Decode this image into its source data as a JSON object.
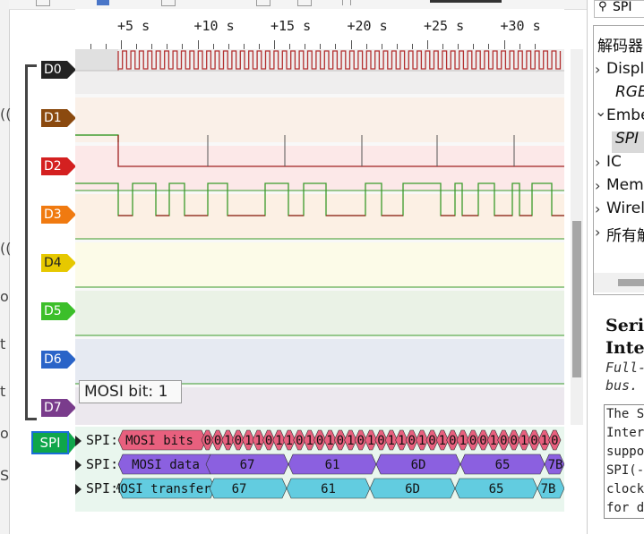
{
  "ruler": {
    "labels": [
      "+5 s",
      "+10 s",
      "+15 s",
      "+20 s",
      "+25 s",
      "+30 s"
    ]
  },
  "channels": [
    {
      "name": "D0",
      "color": "#222222"
    },
    {
      "name": "D1",
      "color": "#8b4a0f"
    },
    {
      "name": "D2",
      "color": "#d42020"
    },
    {
      "name": "D3",
      "color": "#f07a10"
    },
    {
      "name": "D4",
      "color": "#e6c800"
    },
    {
      "name": "D5",
      "color": "#3cbf2a"
    },
    {
      "name": "D6",
      "color": "#2a64c8"
    },
    {
      "name": "D7",
      "color": "#7a3c8c"
    }
  ],
  "tooltip": "MOSI bit: 1",
  "decoder_tag": "SPI",
  "spi_rows": [
    {
      "label": "SPI:",
      "name": "MOSI bits",
      "bits": [
        "0",
        "0",
        "1",
        "0",
        "1",
        "1",
        "0",
        "1",
        "1",
        "0",
        "1",
        "0",
        "1",
        "0",
        "1",
        "0",
        "1",
        "0",
        "1",
        "1",
        "0",
        "1",
        "0",
        "1",
        "0",
        "1",
        "0",
        "0",
        "1",
        "0",
        "0",
        "1",
        "0",
        "1",
        "0",
        "1"
      ]
    },
    {
      "label": "SPI:",
      "name": "MOSI data",
      "values": [
        "67",
        "61",
        "6D",
        "65",
        "7B"
      ]
    },
    {
      "label": "SPI:",
      "name": "MOSI transfers",
      "values": [
        "67",
        "61",
        "6D",
        "65",
        "7B"
      ]
    }
  ],
  "right_panel": {
    "search_value": "SPI",
    "tree": [
      {
        "label": "解码器",
        "indent": 0,
        "chevron": ""
      },
      {
        "label": "Displ",
        "indent": 1,
        "chevron": "›"
      },
      {
        "label": "RGB",
        "indent": 2,
        "chevron": ""
      },
      {
        "label": "Embe",
        "indent": 1,
        "chevron": "⌄"
      },
      {
        "label": "SPI",
        "indent": 2,
        "chevron": ""
      },
      {
        "label": "IC",
        "indent": 1,
        "chevron": "›"
      },
      {
        "label": "Mem",
        "indent": 1,
        "chevron": "›"
      },
      {
        "label": "Wirel",
        "indent": 1,
        "chevron": "›"
      },
      {
        "label": "所有解",
        "indent": 1,
        "chevron": "›"
      }
    ],
    "desc_title_1": "Seri",
    "desc_title_2": "Inte",
    "desc_sub_1": "Full-",
    "desc_sub_2": "bus.",
    "desc_lines": [
      "The S",
      "Inter",
      "suppo",
      "SPI(-",
      "clock",
      "for d"
    ]
  },
  "left_cutoff": [
    "((",
    "((",
    "o",
    "t",
    "t",
    "o",
    "S"
  ]
}
